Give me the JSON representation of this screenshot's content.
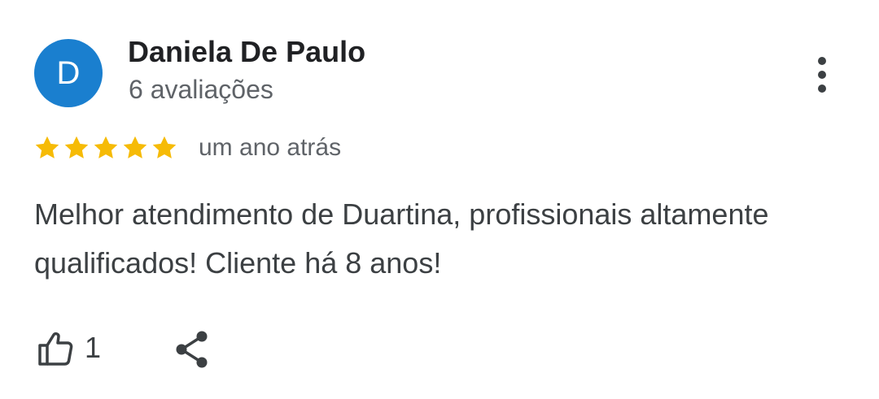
{
  "review": {
    "author": {
      "initial": "D",
      "name": "Daniela De Paulo",
      "review_count": "6 avaliações",
      "avatar_color": "#1a7fcf"
    },
    "rating": {
      "stars": 5,
      "max_stars": 5,
      "star_color": "#f6bb06"
    },
    "time": "um ano atrás",
    "text": "Melhor atendimento de Duartina, profissionais altamente qualificados! Cliente há 8 anos!",
    "likes": "1",
    "icons": {
      "more": "more-vert-icon",
      "like": "thumb-up-icon",
      "share": "share-icon"
    }
  }
}
